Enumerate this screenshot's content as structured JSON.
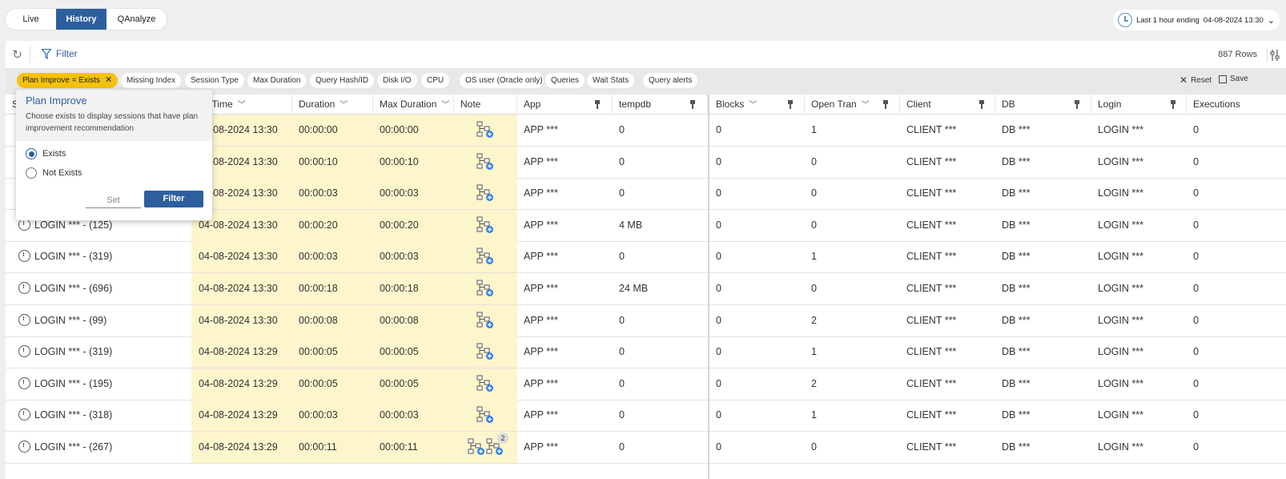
{
  "tabs": {
    "live": "Live",
    "history": "History",
    "qanalyze": "QAnalyze"
  },
  "timerange": {
    "label": "Last 1 hour ending",
    "value": "04-08-2024 13:30",
    "chevron": "⌄"
  },
  "toolbar": {
    "filter_label": "Filter",
    "row_count": "887 Rows"
  },
  "chips": {
    "plan_improve": "Plan Improve = Exists",
    "missing_index": "Missing Index",
    "session_type": "Session Type",
    "max_duration": "Max Duration",
    "query_hash": "Query Hash/ID",
    "disk_io": "Disk I/O",
    "cpu": "CPU",
    "os_user": "OS user (Oracle only)",
    "queries": "Queries",
    "wait_stats": "Wait Stats",
    "query_alerts": "Query alerts",
    "reset": "Reset",
    "save": "Save"
  },
  "columns": {
    "session": "S",
    "start_time": "rt Time",
    "duration": "Duration",
    "max_duration": "Max Duration",
    "note": "Note",
    "app": "App",
    "tempdb": "tempdb",
    "blocks": "Blocks",
    "open_tran": "Open Tran",
    "client": "Client",
    "db": "DB",
    "login": "Login",
    "executions": "Executions"
  },
  "rows": [
    {
      "session": "",
      "start": "04-08-2024 13:30",
      "duration": "00:00:00",
      "max": "00:00:00",
      "app": "APP ***",
      "tempdb": "0",
      "blocks": "0",
      "open": "1",
      "client": "CLIENT ***",
      "db": "DB ***",
      "login": "LOGIN ***",
      "exec": "0"
    },
    {
      "session": "",
      "start": "04-08-2024 13:30",
      "duration": "00:00:10",
      "max": "00:00:10",
      "app": "APP ***",
      "tempdb": "0",
      "blocks": "0",
      "open": "0",
      "client": "CLIENT ***",
      "db": "DB ***",
      "login": "LOGIN ***",
      "exec": "0"
    },
    {
      "session": "",
      "start": "04-08-2024 13:30",
      "duration": "00:00:03",
      "max": "00:00:03",
      "app": "APP ***",
      "tempdb": "0",
      "blocks": "0",
      "open": "0",
      "client": "CLIENT ***",
      "db": "DB ***",
      "login": "LOGIN ***",
      "exec": "0"
    },
    {
      "session": "LOGIN *** - (125)",
      "start": "04-08-2024 13:30",
      "duration": "00:00:20",
      "max": "00:00:20",
      "app": "APP ***",
      "tempdb": "4 MB",
      "blocks": "0",
      "open": "0",
      "client": "CLIENT ***",
      "db": "DB ***",
      "login": "LOGIN ***",
      "exec": "0"
    },
    {
      "session": "LOGIN *** - (319)",
      "start": "04-08-2024 13:30",
      "duration": "00:00:03",
      "max": "00:00:03",
      "app": "APP ***",
      "tempdb": "0",
      "blocks": "0",
      "open": "1",
      "client": "CLIENT ***",
      "db": "DB ***",
      "login": "LOGIN ***",
      "exec": "0"
    },
    {
      "session": "LOGIN *** - (696)",
      "start": "04-08-2024 13:30",
      "duration": "00:00:18",
      "max": "00:00:18",
      "app": "APP ***",
      "tempdb": "24 MB",
      "blocks": "0",
      "open": "0",
      "client": "CLIENT ***",
      "db": "DB ***",
      "login": "LOGIN ***",
      "exec": "0"
    },
    {
      "session": "LOGIN *** - (99)",
      "start": "04-08-2024 13:30",
      "duration": "00:00:08",
      "max": "00:00:08",
      "app": "APP ***",
      "tempdb": "0",
      "blocks": "0",
      "open": "2",
      "client": "CLIENT ***",
      "db": "DB ***",
      "login": "LOGIN ***",
      "exec": "0"
    },
    {
      "session": "LOGIN *** - (319)",
      "start": "04-08-2024 13:29",
      "duration": "00:00:05",
      "max": "00:00:05",
      "app": "APP ***",
      "tempdb": "0",
      "blocks": "0",
      "open": "1",
      "client": "CLIENT ***",
      "db": "DB ***",
      "login": "LOGIN ***",
      "exec": "0"
    },
    {
      "session": "LOGIN *** - (195)",
      "start": "04-08-2024 13:29",
      "duration": "00:00:05",
      "max": "00:00:05",
      "app": "APP ***",
      "tempdb": "0",
      "blocks": "0",
      "open": "2",
      "client": "CLIENT ***",
      "db": "DB ***",
      "login": "LOGIN ***",
      "exec": "0"
    },
    {
      "session": "LOGIN *** - (318)",
      "start": "04-08-2024 13:29",
      "duration": "00:00:03",
      "max": "00:00:03",
      "app": "APP ***",
      "tempdb": "0",
      "blocks": "0",
      "open": "1",
      "client": "CLIENT ***",
      "db": "DB ***",
      "login": "LOGIN ***",
      "exec": "0"
    },
    {
      "session": "LOGIN *** - (267)",
      "start": "04-08-2024 13:29",
      "duration": "00:00:11",
      "max": "00:00:11",
      "app": "APP ***",
      "tempdb": "0",
      "blocks": "0",
      "open": "0",
      "client": "CLIENT ***",
      "db": "DB ***",
      "login": "LOGIN ***",
      "exec": "0",
      "note_count": "2"
    }
  ],
  "popup": {
    "title": "Plan Improve",
    "description": "Choose exists to display sessions that have plan improvement recommendation",
    "option_exists": "Exists",
    "option_not_exists": "Not Exists",
    "selected": "Exists",
    "set_label": "Set",
    "filter_label": "Filter"
  },
  "colors": {
    "accent": "#2d5f9e",
    "active_chip": "#f6c20e",
    "highlight_col": "#fdf5cc",
    "plan_badge": "#2f80ed"
  }
}
